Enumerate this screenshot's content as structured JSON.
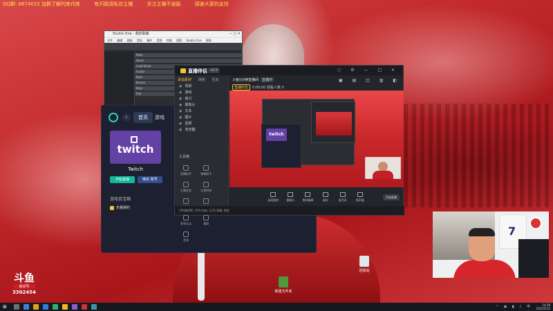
{
  "overlay": {
    "ticker": [
      "QQ群: 6674015 加群了解代练代练",
      "有问题请私信主播",
      "关注主播不迷路",
      "感谢大家的支持"
    ]
  },
  "daw": {
    "title": "Studio One - 我的歌曲",
    "menu": [
      "文件",
      "编辑",
      "歌曲",
      "音轨",
      "事件",
      "音频",
      "传输",
      "视图",
      "Studio One",
      "帮助"
    ],
    "tracks": [
      "Main",
      "Vocal",
      "Lead Vocal",
      "Guitar",
      "Bass",
      "Drums",
      "Keys",
      "Pad"
    ]
  },
  "launcher": {
    "tabs": [
      "首页",
      "游戏"
    ],
    "active_tab": "首页",
    "card_brand": "twitch",
    "card_name": "Twitch",
    "primary_button": "开始直播",
    "secondary_button": "绑定 账号",
    "section_title": "游戏百宝箱",
    "item_label": "无畏契约"
  },
  "obs": {
    "brand": "直播伴侣",
    "version": "v5.0",
    "side_tabs": [
      "添加素材",
      "场景",
      "互动"
    ],
    "sources": [
      "场景",
      "游戏",
      "窗口",
      "摄像头",
      "文本",
      "图片",
      "音频",
      "浏览器"
    ],
    "tools_title": "工具箱",
    "tools": [
      "直播助手",
      "弹幕助手",
      "主播任务",
      "礼物特效",
      "连麦PK",
      "数据中心",
      "更多玩法",
      "美颜",
      "音效"
    ],
    "stream_title": "斗鱼5分钟直播间",
    "stream_tag": "直播中",
    "stream_pill": "直播时长",
    "stream_meta": "0:00:00  观看人数 0",
    "preview_brand": "twitch",
    "controls": [
      "画面旋转",
      "摄像头",
      "素材编辑",
      "录制",
      "麦克风",
      "扬声器"
    ],
    "start_label": "开始直播",
    "status": "CPU使用率: 12%   内存: 3.2G   网络: 良好"
  },
  "webcam": {
    "jersey_number": "7"
  },
  "desktop": {
    "icons": [
      {
        "name": "回收站"
      },
      {
        "name": "新建文件夹"
      }
    ]
  },
  "douyu": {
    "logo": "斗鱼",
    "tag": "房间号",
    "room_id": "3302454"
  },
  "taskbar": {
    "start_glyph": "⊞",
    "time": "14:38",
    "date": "2022/5/12"
  },
  "colors": {
    "twitch": "#6441a5",
    "accent_green": "#10b99a",
    "obs_accent": "#f7c23a",
    "wallpaper_red": "#c22a2c"
  }
}
